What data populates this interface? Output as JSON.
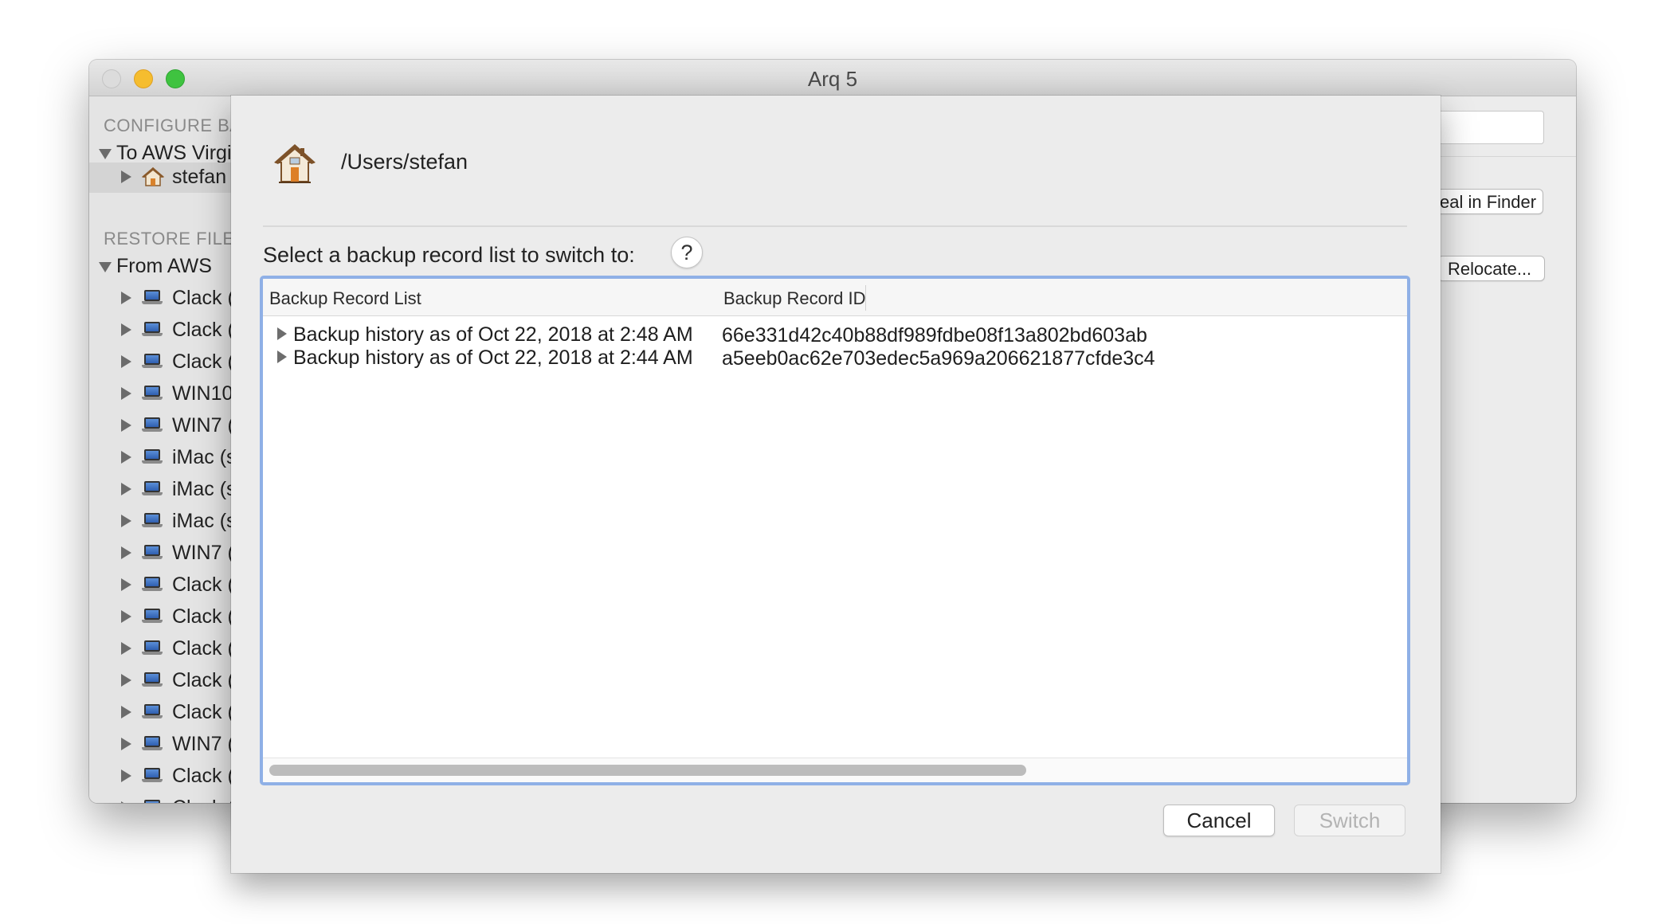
{
  "window": {
    "title": "Arq 5"
  },
  "sidebar": {
    "configure_title": "CONFIGURE BA",
    "configure_items": [
      {
        "label": "To AWS Virgi",
        "expanded": true,
        "icon": "none"
      },
      {
        "label": "stefan",
        "expanded": false,
        "icon": "home-icon",
        "selected": true
      }
    ],
    "restore_title": "RESTORE FILES",
    "restore_root": "From AWS",
    "restore_items": [
      {
        "label": "Clack ("
      },
      {
        "label": "Clack ("
      },
      {
        "label": "Clack ("
      },
      {
        "label": "WIN10"
      },
      {
        "label": "WIN7 ("
      },
      {
        "label": "iMac (s"
      },
      {
        "label": "iMac (s"
      },
      {
        "label": "iMac (s"
      },
      {
        "label": "WIN7 ("
      },
      {
        "label": "Clack ("
      },
      {
        "label": "Clack ("
      },
      {
        "label": "Clack ("
      },
      {
        "label": "Clack ("
      },
      {
        "label": "Clack ("
      },
      {
        "label": "WIN7 ("
      },
      {
        "label": "Clack ("
      },
      {
        "label": "Clack ("
      }
    ]
  },
  "background_pane": {
    "reveal_label": "eal in Finder",
    "relocate_label": "Relocate..."
  },
  "sheet": {
    "path": "/Users/stefan",
    "prompt": "Select a backup record list to switch to:",
    "help_label": "?",
    "columns": [
      "Backup Record List",
      "Backup Record ID"
    ],
    "rows": [
      {
        "name": "Backup history as of Oct 22, 2018 at 2:48 AM",
        "id": "66e331d42c40b88df989fdbe08f13a802bd603ab"
      },
      {
        "name": "Backup history as of Oct 22, 2018 at 2:44 AM",
        "id": "a5eeb0ac62e703edec5a969a206621877cfde3c4"
      }
    ],
    "cancel_label": "Cancel",
    "switch_label": "Switch",
    "switch_enabled": false
  }
}
